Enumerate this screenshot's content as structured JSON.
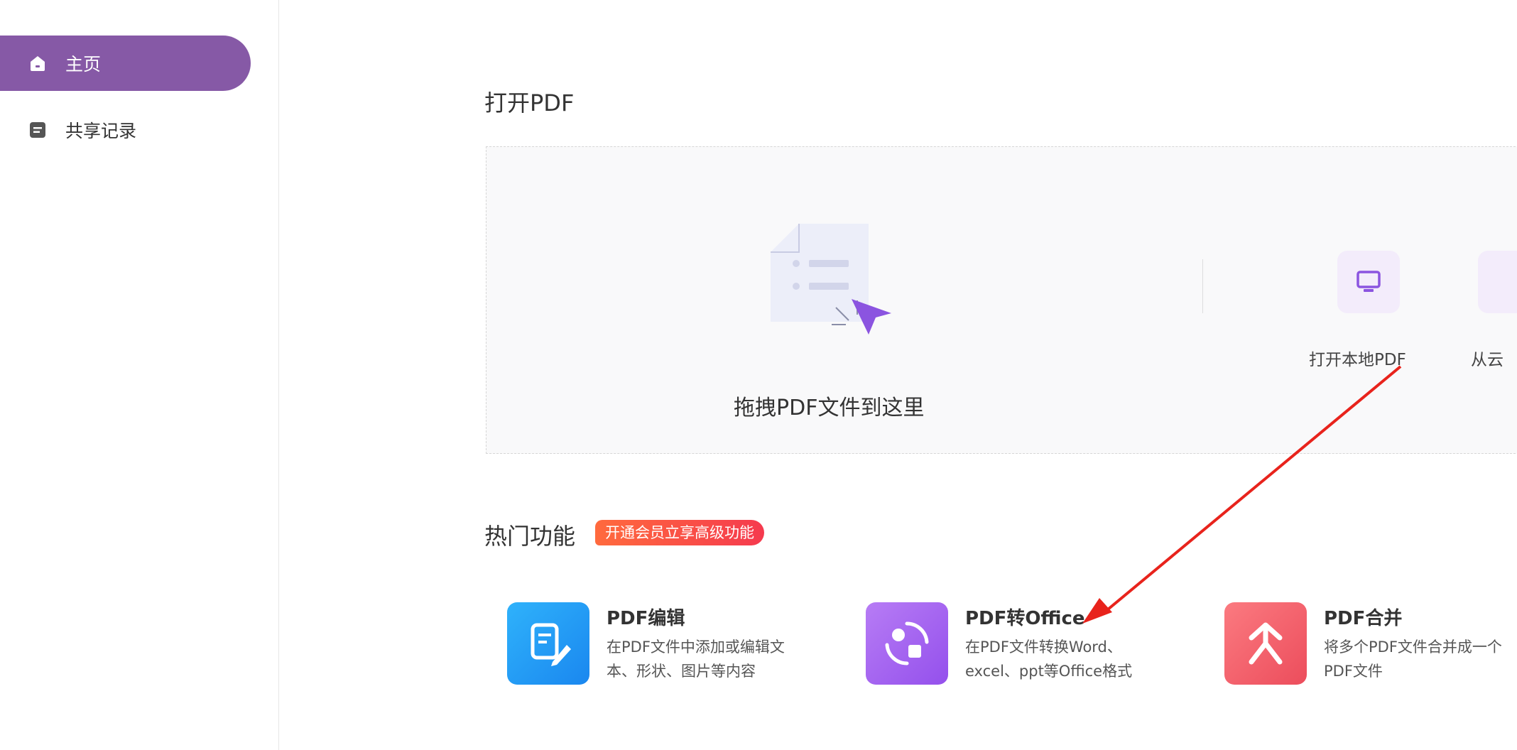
{
  "sidebar": {
    "items": [
      {
        "label": "主页",
        "icon": "home-icon",
        "active": true
      },
      {
        "label": "共享记录",
        "icon": "document-icon",
        "active": false
      }
    ]
  },
  "main": {
    "open_section_title": "打开PDF",
    "drop_text": "拖拽PDF文件到这里",
    "open_options": [
      {
        "label": "打开本地PDF",
        "icon": "monitor-icon"
      },
      {
        "label": "从云",
        "icon": "cloud-icon"
      }
    ],
    "hot_section_title": "热门功能",
    "vip_badge": "开通会员立享高级功能",
    "features": [
      {
        "title": "PDF编辑",
        "desc_line1": "在PDF文件中添加或编辑文",
        "desc_line2": "本、形状、图片等内容",
        "icon": "edit-icon",
        "color": "#1e9bf0"
      },
      {
        "title": "PDF转Office",
        "desc_line1": "在PDF文件转换Word、",
        "desc_line2": "excel、ppt等Office格式",
        "icon": "convert-icon",
        "color": "#a65ff0"
      },
      {
        "title": "PDF合并",
        "desc_line1": "将多个PDF文件合并成一个",
        "desc_line2": "PDF文件",
        "icon": "merge-icon",
        "color": "#f4606c"
      }
    ]
  },
  "colors": {
    "accent": "#8659a6",
    "annotation_arrow": "#e8231c"
  }
}
